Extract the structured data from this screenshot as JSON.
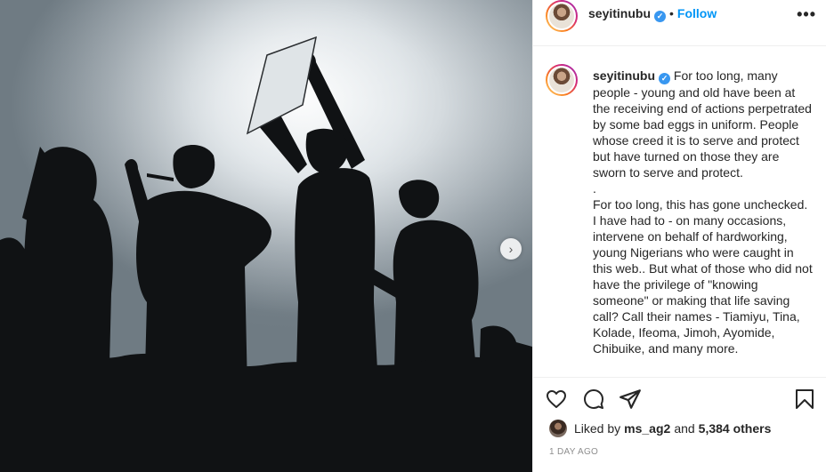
{
  "post": {
    "username": "seyitinubu",
    "verified_mark": "✓",
    "follow_separator": "•",
    "follow_label": "Follow",
    "more_label": "•••",
    "caption": "For too long, many people - young and old have been at the receiving end of actions perpetrated by some bad eggs in uniform. People whose creed it is to serve and protect but have turned on those they are sworn to serve and protect.\n.\nFor too long, this has gone unchecked. I have had to - on many occasions, intervene on behalf of hardworking, young Nigerians who were caught in this web.. But what of those who did not have the privilege of \"knowing someone\" or making that life saving call? Call their names - Tiamiyu, Tina, Kolade, Ifeoma, Jimoh, Ayomide, Chibuike, and many more.",
    "carousel_next": "›"
  },
  "likes": {
    "prefix": "Liked by",
    "first_user": "ms_ag2",
    "joiner": "and",
    "others": "5,384 others"
  },
  "timestamp": "1 DAY AGO",
  "icons": {
    "like": "heart-icon",
    "comment": "comment-icon",
    "share": "paper-plane-icon",
    "save": "bookmark-icon"
  },
  "colors": {
    "follow": "#0095f6",
    "verified": "#3897f0",
    "text": "#262626",
    "muted": "#8e8e8e"
  }
}
